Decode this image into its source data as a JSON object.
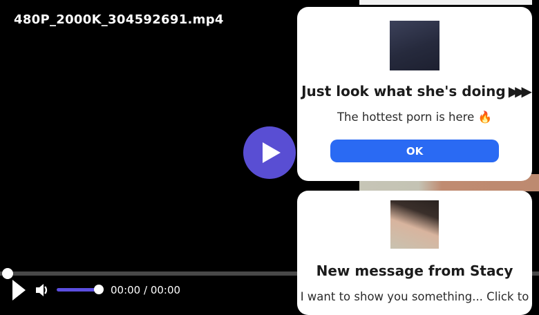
{
  "player": {
    "title": "480P_2000K_304592691.mp4",
    "current_time": "00:00",
    "time_separator": " / ",
    "duration": "00:00"
  },
  "popup_offer": {
    "thumbnail": "ad-video-thumbnail",
    "title_text": "Just look what she's doing",
    "title_arrows": "▶▶▶",
    "subtitle": "The hottest porn is here 🔥",
    "ok_label": "OK"
  },
  "popup_message": {
    "avatar": "stacy-avatar-photo",
    "title": "New message from Stacy",
    "body": "I want to show you something... Click to"
  },
  "colors": {
    "accent_purple": "#594ed3",
    "volume_purple": "#5b4ee0",
    "ok_button_blue": "#2a6af3",
    "progress_track_gray": "#484848",
    "popup_background": "#ffffff",
    "page_background": "#000000"
  }
}
